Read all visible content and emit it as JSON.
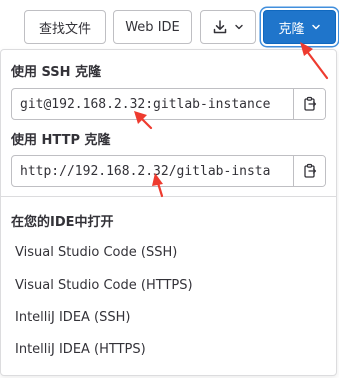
{
  "toolbar": {
    "find_file_label": "查找文件",
    "web_ide_label": "Web IDE",
    "download_icon": "download-icon",
    "clone_label": "克隆"
  },
  "clone_panel": {
    "ssh_title": "使用 SSH 克隆",
    "ssh_url": "git@192.168.2.32:gitlab-instance",
    "http_title": "使用 HTTP 克隆",
    "http_url": "http://192.168.2.32/gitlab-insta",
    "open_in_ide_title": "在您的IDE中打开",
    "ide_options": [
      "Visual Studio Code (SSH)",
      "Visual Studio Code (HTTPS)",
      "IntelliJ IDEA (SSH)",
      "IntelliJ IDEA (HTTPS)"
    ]
  },
  "colors": {
    "primary": "#1f75cb",
    "annotation_arrow": "#ee3b2f"
  }
}
